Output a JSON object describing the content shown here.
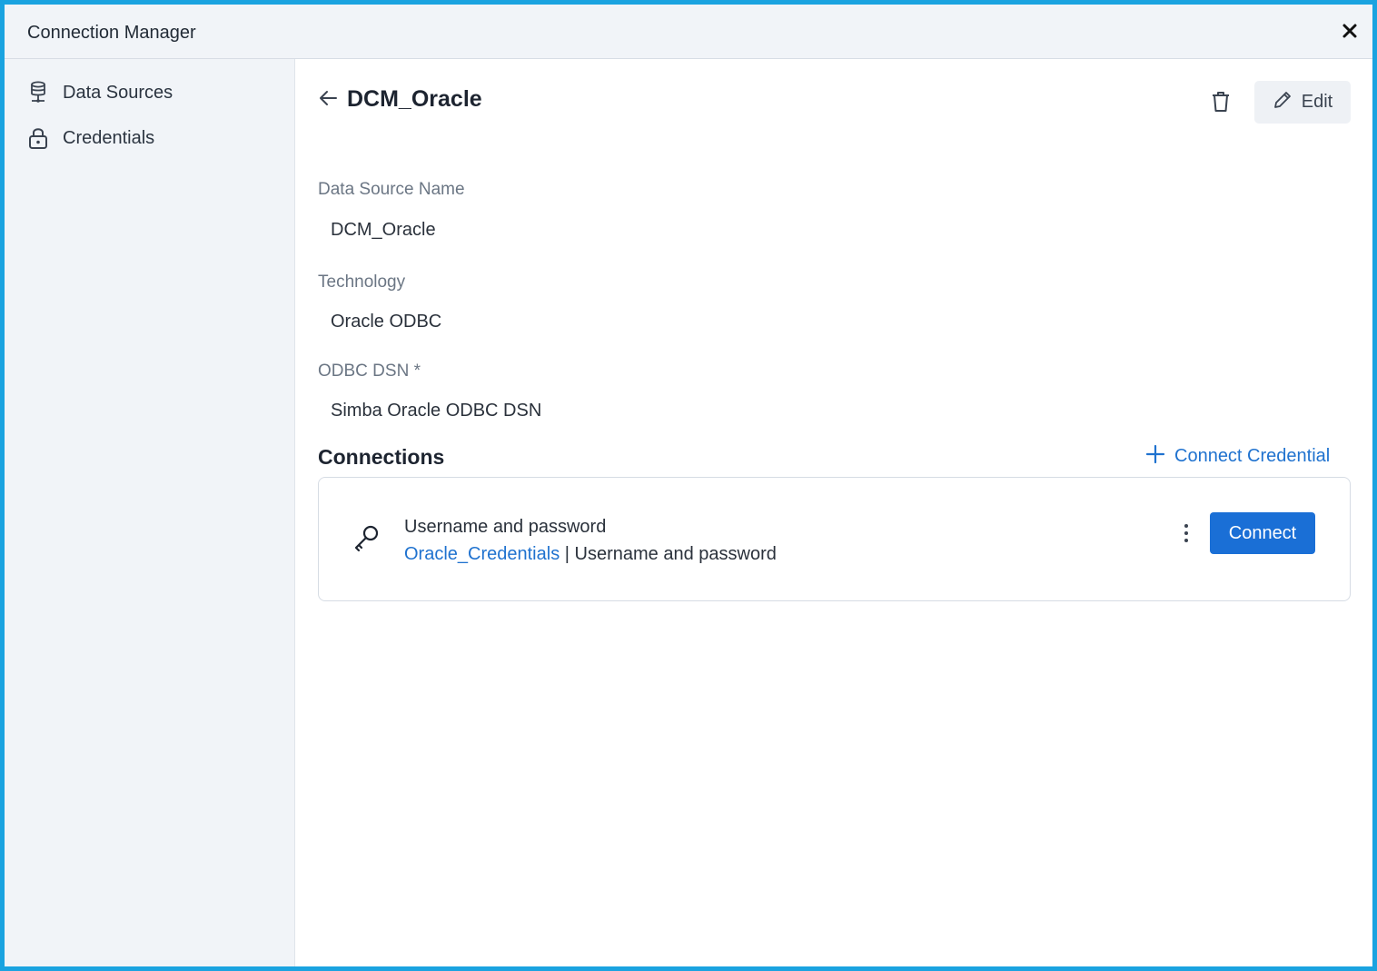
{
  "window": {
    "title": "Connection Manager",
    "close_icon": "close-icon"
  },
  "sidebar": {
    "items": [
      {
        "label": "Data Sources",
        "icon": "database-icon"
      },
      {
        "label": "Credentials",
        "icon": "lock-icon"
      }
    ]
  },
  "header": {
    "title": "DCM_Oracle",
    "back_icon": "arrow-left-icon",
    "delete_icon": "trash-icon",
    "edit_label": "Edit"
  },
  "fields": [
    {
      "label": "Data Source Name",
      "value": "DCM_Oracle"
    },
    {
      "label": "Technology",
      "value": "Oracle ODBC"
    },
    {
      "label": "ODBC DSN *",
      "value": "Simba Oracle ODBC DSN"
    }
  ],
  "connections": {
    "title": "Connections",
    "add_label": "Connect Credential",
    "items": [
      {
        "type": "Username and password",
        "credential_name": "Oracle_Credentials",
        "separator": "|",
        "credential_type": "Username and password",
        "action_label": "Connect"
      }
    ]
  },
  "colors": {
    "accent": "#1a6fd6",
    "link": "#1f72cf",
    "frame_border": "#1aa3e0",
    "sidebar_bg": "#f1f4f8"
  }
}
